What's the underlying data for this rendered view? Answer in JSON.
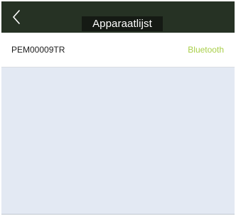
{
  "header": {
    "title": "Apparaatlijst",
    "back_icon": "chevron-left-icon"
  },
  "devices": [
    {
      "name": "PEM00009TR",
      "connection": "Bluetooth"
    }
  ],
  "colors": {
    "header_background": "#263224",
    "title_background": "#151a14",
    "connection_text": "#a9cf49",
    "page_background": "#e3e9f3"
  }
}
